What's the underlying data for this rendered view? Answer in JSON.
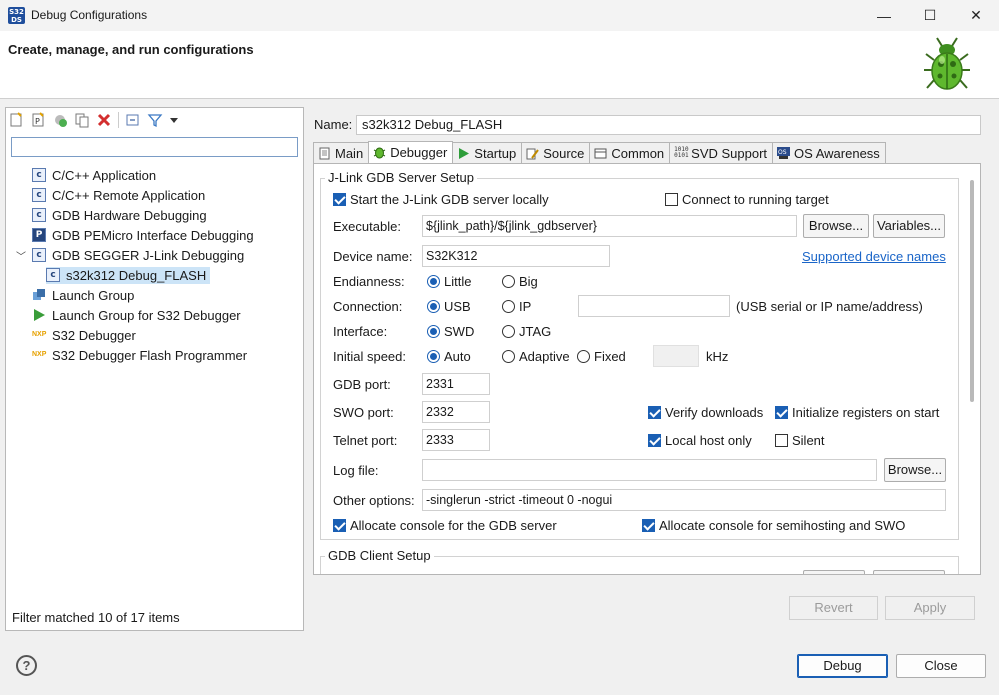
{
  "window": {
    "title": "Debug Configurations",
    "app_icon_text_1": "S32",
    "app_icon_text_2": "DS",
    "minimize": "—",
    "maximize": "☐",
    "close": "✕"
  },
  "header": {
    "title": "Create, manage, and run configurations"
  },
  "tree": {
    "items": [
      {
        "label": "C/C++ Application",
        "icon": "c-config-icon"
      },
      {
        "label": "C/C++ Remote Application",
        "icon": "c-config-icon"
      },
      {
        "label": "GDB Hardware Debugging",
        "icon": "c-config-icon"
      },
      {
        "label": "GDB PEMicro Interface Debugging",
        "icon": "pemicro-icon"
      },
      {
        "label": "GDB SEGGER J-Link Debugging",
        "icon": "c-config-icon"
      },
      {
        "label": "s32k312 Debug_FLASH",
        "icon": "c-config-icon"
      },
      {
        "label": "Launch Group",
        "icon": "launch-group-icon"
      },
      {
        "label": "Launch Group for S32 Debugger",
        "icon": "launch-s32-icon"
      },
      {
        "label": "S32 Debugger",
        "icon": "s32-debugger-icon"
      },
      {
        "label": "S32 Debugger Flash Programmer",
        "icon": "s32-flash-icon"
      }
    ],
    "filter_status": "Filter matched 10 of 17 items"
  },
  "config": {
    "name_label": "Name:",
    "name_value": "s32k312 Debug_FLASH",
    "tabs": [
      "Main",
      "Debugger",
      "Startup",
      "Source",
      "Common",
      "SVD Support",
      "OS Awareness"
    ],
    "server": {
      "group_title": "J-Link GDB Server Setup",
      "start_locally": "Start the J-Link GDB server locally",
      "connect_running": "Connect to running target",
      "executable_label": "Executable:",
      "executable_value": "${jlink_path}/${jlink_gdbserver}",
      "browse": "Browse...",
      "variables": "Variables...",
      "device_label": "Device name:",
      "device_value": "S32K312",
      "supported_link": "Supported device names",
      "endianness_label": "Endianness:",
      "little": "Little",
      "big": "Big",
      "connection_label": "Connection:",
      "usb": "USB",
      "ip": "IP",
      "connection_hint": "(USB serial or IP name/address)",
      "interface_label": "Interface:",
      "swd": "SWD",
      "jtag": "JTAG",
      "speed_label": "Initial speed:",
      "auto": "Auto",
      "adaptive": "Adaptive",
      "fixed": "Fixed",
      "khz": "kHz",
      "gdb_port_label": "GDB port:",
      "gdb_port": "2331",
      "swo_port_label": "SWO port:",
      "swo_port": "2332",
      "telnet_port_label": "Telnet port:",
      "telnet_port": "2333",
      "verify_downloads": "Verify downloads",
      "init_registers": "Initialize registers on start",
      "local_host_only": "Local host only",
      "silent": "Silent",
      "log_file_label": "Log file:",
      "log_browse": "Browse...",
      "other_options_label": "Other options:",
      "other_options_value": "-singlerun -strict -timeout 0 -nogui",
      "alloc_gdb_console": "Allocate console for the GDB server",
      "alloc_semihosting": "Allocate console for semihosting and SWO"
    },
    "client": {
      "group_title": "GDB Client Setup"
    },
    "revert": "Revert",
    "apply": "Apply"
  },
  "footer": {
    "help": "?",
    "debug": "Debug",
    "close": "Close"
  },
  "colors": {
    "accent": "#1a5fb4",
    "link": "#1a65c8",
    "selection": "#cce4f7"
  }
}
